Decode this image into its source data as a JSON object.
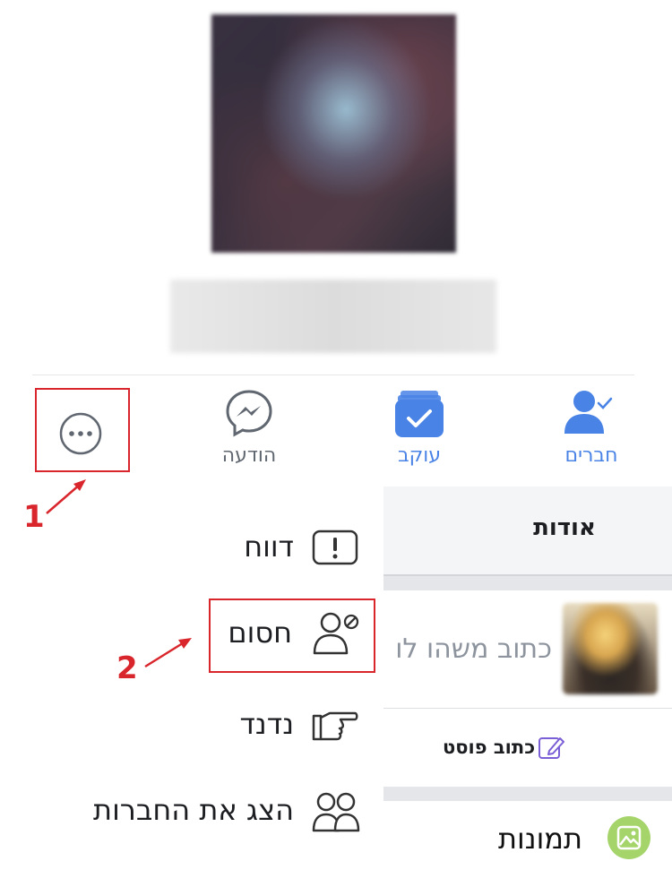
{
  "profile": {},
  "actions": {
    "friends_label": "חברים",
    "following_label": "עוקב",
    "message_label": "הודעה",
    "more_icon": "more-icon"
  },
  "annotations": {
    "step1": "1",
    "step2": "2",
    "color": "#d9262c"
  },
  "menu": {
    "items": [
      {
        "label": "דווח",
        "icon": "report-icon"
      },
      {
        "label": "חסום",
        "icon": "block-user-icon"
      },
      {
        "label": "נדנד",
        "icon": "poke-icon"
      },
      {
        "label": "הצג את החברות",
        "icon": "friendship-icon"
      }
    ]
  },
  "page": {
    "about_tab": "אודות",
    "composer_placeholder": "כתוב משהו לו",
    "write_post": "כתוב פוסט",
    "photos_label": "תמונות"
  },
  "colors": {
    "accent": "#4a83e6",
    "text": "#1c1e21",
    "muted": "#8d949e"
  }
}
